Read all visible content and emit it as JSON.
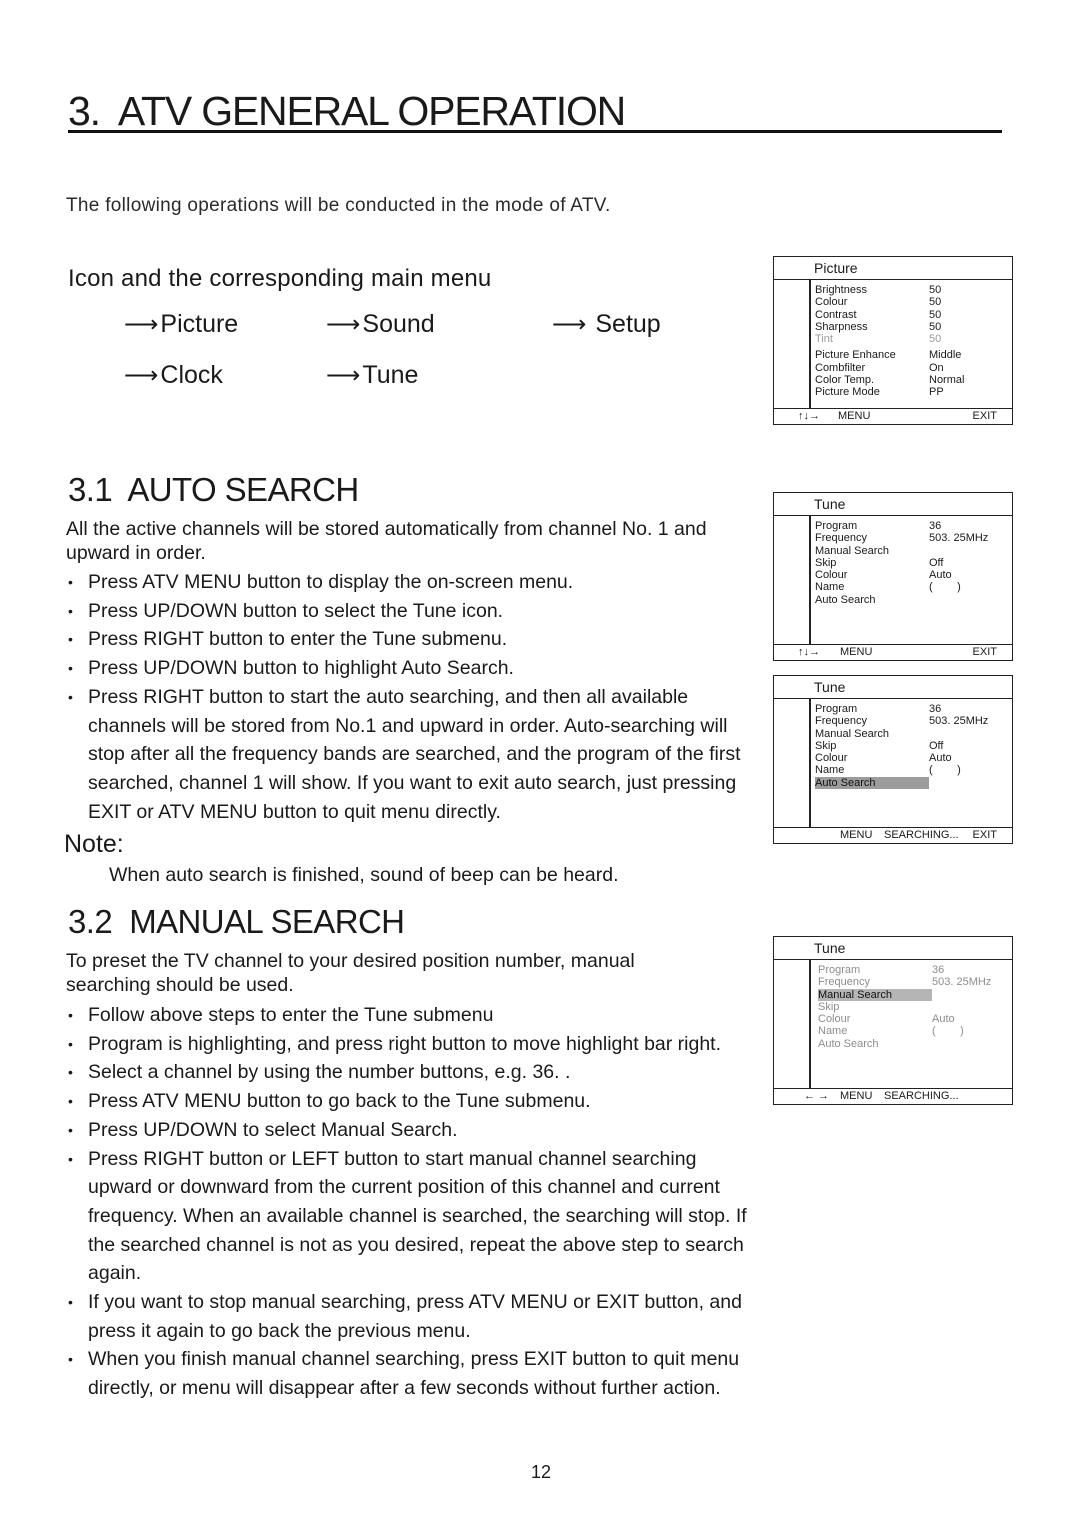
{
  "page": {
    "title": "3.  ATV GENERAL OPERATION",
    "intro": "The following operations will be conducted in the mode of ATV.",
    "page_number": "12"
  },
  "main_menu": {
    "heading": "Icon and the corresponding main menu",
    "items": [
      {
        "icon": "arrow-right-icon",
        "label": "Picture"
      },
      {
        "icon": "arrow-right-icon",
        "label": "Sound"
      },
      {
        "icon": "arrow-right-icon",
        "label": "Setup"
      },
      {
        "icon": "arrow-right-icon",
        "label": "Clock"
      },
      {
        "icon": "arrow-right-icon",
        "label": "Tune"
      }
    ]
  },
  "auto_search": {
    "title": "3.1  AUTO SEARCH",
    "intro": "All the active channels will be stored automatically from channel No. 1 and upward in order.",
    "steps": [
      "Press ATV MENU button to display the on-screen menu.",
      "Press UP/DOWN button to select the Tune icon.",
      "Press RIGHT button to enter the Tune submenu.",
      "Press UP/DOWN button to highlight Auto Search.",
      "Press RIGHT button to start the auto searching, and then all available channels will be stored from No.1 and upward in order. Auto-searching will stop after all the frequency bands are searched, and the program of the first searched, channel 1 will show. If you want to exit auto search, just pressing EXIT or ATV MENU button to quit menu directly."
    ],
    "note_label": "Note:",
    "note_text": "When auto search is finished, sound of beep can be heard."
  },
  "manual_search": {
    "title": "3.2  MANUAL SEARCH",
    "intro": "To preset the TV channel to your desired position number, manual searching should be used.",
    "steps": [
      "Follow above steps to enter the Tune submenu",
      "Program is highlighting, and press right button to move highlight bar right.",
      "Select a channel by using the number buttons, e.g. 36. .",
      "Press ATV MENU button to go back to the Tune submenu.",
      "Press UP/DOWN to select Manual Search.",
      "Press RIGHT button or LEFT button to start manual channel searching upward or downward from the current position of this channel and current frequency. When an available channel is searched, the searching will stop. If the searched channel is not as you desired, repeat the above step to search again.",
      "If you want to stop manual searching, press ATV MENU or EXIT button, and press it again to go back the previous menu.",
      "When you finish manual channel searching, press EXIT button to quit menu directly, or menu will disappear after a few seconds without further action."
    ]
  },
  "osd_picture": {
    "header": "Picture",
    "rows": [
      {
        "key": "Brightness",
        "value": "50"
      },
      {
        "key": "Colour",
        "value": "50"
      },
      {
        "key": "Contrast",
        "value": "50"
      },
      {
        "key": "Sharpness",
        "value": "50"
      },
      {
        "key": "Tint",
        "value": "50",
        "state": "disabled"
      },
      {
        "key": "Picture Enhance",
        "value": "Middle"
      },
      {
        "key": "Combfilter",
        "value": "On"
      },
      {
        "key": "Color Temp.",
        "value": "Normal"
      },
      {
        "key": "Picture Mode",
        "value": "PP"
      }
    ],
    "footer": {
      "nav_icons": "up-down-right-arrows",
      "menu": "MENU",
      "exit": "EXIT"
    }
  },
  "osd_tune_1": {
    "header": "Tune",
    "rows": [
      {
        "key": "Program",
        "value": "36"
      },
      {
        "key": "Frequency",
        "value": "503. 25MHz"
      },
      {
        "key": "Manual Search",
        "value": ""
      },
      {
        "key": "Skip",
        "value": "Off"
      },
      {
        "key": "Colour",
        "value": "Auto"
      },
      {
        "key": "Name",
        "value": "(        )"
      },
      {
        "key": "Auto Search",
        "value": ""
      }
    ],
    "footer": {
      "nav_icons": "up-down-right-arrows",
      "menu": "MENU",
      "exit": "EXIT"
    }
  },
  "osd_tune_2": {
    "header": "Tune",
    "highlighted": "Auto Search",
    "rows": [
      {
        "key": "Program",
        "value": "36"
      },
      {
        "key": "Frequency",
        "value": "503. 25MHz"
      },
      {
        "key": "Manual Search",
        "value": ""
      },
      {
        "key": "Skip",
        "value": "Off"
      },
      {
        "key": "Colour",
        "value": "Auto"
      },
      {
        "key": "Name",
        "value": "(        )"
      },
      {
        "key": "Auto Search",
        "value": ""
      }
    ],
    "footer": {
      "menu": "MENU",
      "status": "SEARCHING...",
      "exit": "EXIT"
    }
  },
  "osd_tune_3": {
    "header": "Tune",
    "highlighted": "Manual Search",
    "rows": [
      {
        "key": "Program",
        "value": "36"
      },
      {
        "key": "Frequency",
        "value": "503. 25MHz"
      },
      {
        "key": "Manual Search",
        "value": ""
      },
      {
        "key": "Skip",
        "value": ""
      },
      {
        "key": "Colour",
        "value": "Auto"
      },
      {
        "key": "Name",
        "value": "(        )"
      },
      {
        "key": "Auto Search",
        "value": ""
      }
    ],
    "footer": {
      "nav_icons": "left-right-arrows",
      "menu": "MENU",
      "status": "SEARCHING..."
    }
  }
}
